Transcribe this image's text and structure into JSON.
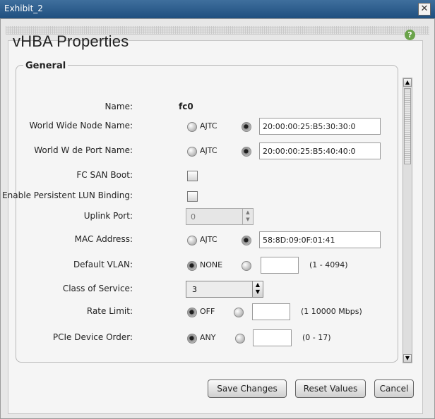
{
  "window": {
    "title": "Exhibit_2",
    "close_glyph": "✕"
  },
  "dialog": {
    "heading": "vHBA Properties",
    "help_icon": "?"
  },
  "general": {
    "section_title": "General",
    "name": {
      "label": "Name:",
      "value": "fc0"
    },
    "wwnn": {
      "label": "World Wide Node Name:",
      "auto_label": "AJTC",
      "value": "20:00:00:25:B5:30:30:0"
    },
    "wwpn": {
      "label": "World W de Port Name:",
      "auto_label": "AJTC",
      "value": "20:00:00:25:B5:40:40:0"
    },
    "fc_san_boot": {
      "label": "FC SAN Boot:"
    },
    "persistent_lun": {
      "label": "Enable Persistent LUN Binding:"
    },
    "uplink_port": {
      "label": "Uplink Port:",
      "value": "0"
    },
    "mac_address": {
      "label": "MAC Address:",
      "auto_label": "AJTC",
      "value": "58:8D:09:0F:01:41"
    },
    "default_vlan": {
      "label": "Default VLAN:",
      "none_label": "NONE",
      "value": "",
      "range": "(1 - 4094)"
    },
    "class_of_service": {
      "label": "Class of Service:",
      "value": "3"
    },
    "rate_limit": {
      "label": "Rate Limit:",
      "off_label": "OFF",
      "value": "",
      "range": "(1  10000 Mbps)"
    },
    "pcie_order": {
      "label": "PCIe Device Order:",
      "any_label": "ANY",
      "value": "",
      "range": "(0 - 17)"
    }
  },
  "footer": {
    "save_label": "Save Changes",
    "reset_label": "Reset Values",
    "cancel_label": "Cancel"
  }
}
